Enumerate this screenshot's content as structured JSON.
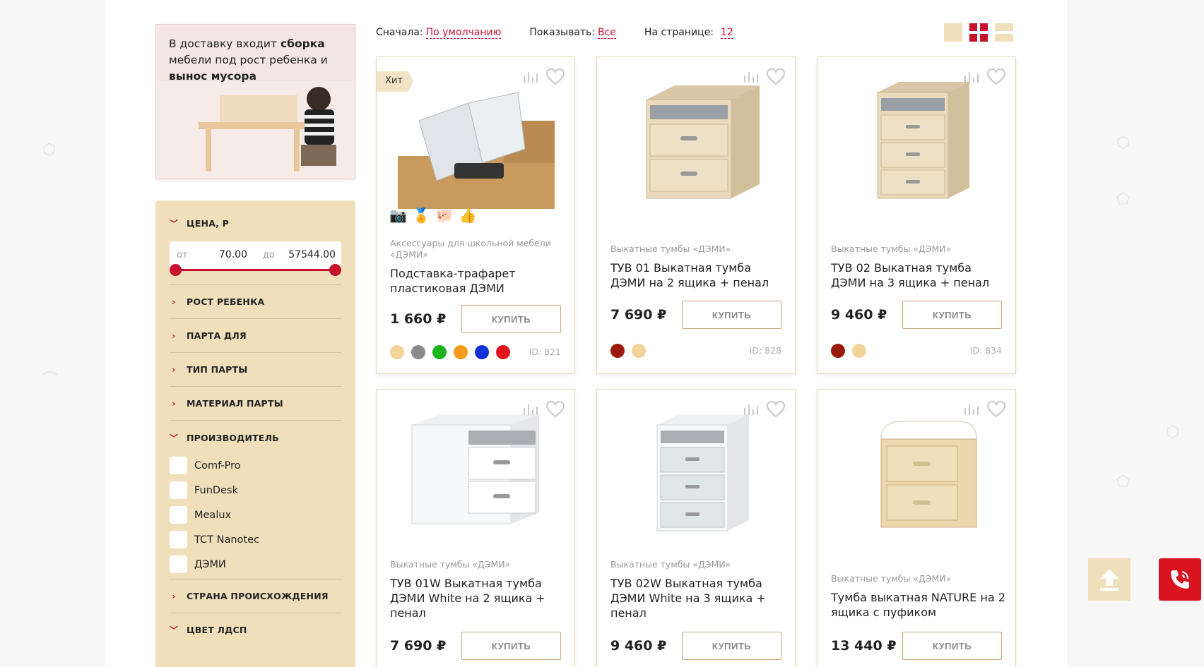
{
  "promo": {
    "line1_pre": "В доставку входит ",
    "line1_bold": "сборка",
    "line2": "мебели под рост ребенка и",
    "line3_bold": "вынос мусора"
  },
  "filters": {
    "price": {
      "label": "ЦЕНА, Р",
      "from_label": "от",
      "from_value": "70.00",
      "to_label": "до",
      "to_value": "57544.00",
      "range_fraction": [
        0,
        1
      ]
    },
    "sections": [
      "РОСТ РЕБЕНКА",
      "ПАРТА ДЛЯ",
      "ТИП ПАРТЫ",
      "МАТЕРИАЛ ПАРТЫ"
    ],
    "manufacturer": {
      "label": "ПРОИЗВОДИТЕЛЬ",
      "options": [
        "Comf-Pro",
        "FunDesk",
        "Mealux",
        "TCT Nanotec",
        "ДЭМИ"
      ]
    },
    "country": "СТРАНА ПРОИСХОЖДЕНИЯ",
    "color": "ЦВЕТ ЛДСП"
  },
  "sortbar": {
    "sort_label": "Сначала:",
    "sort_value": "По умолчанию",
    "show_label": "Показывать:",
    "show_value": "Все",
    "perpage_label": "На странице:",
    "perpage_value": "12"
  },
  "colors": {
    "accent": "#c8102e",
    "beige": "#efdfbb"
  },
  "products": [
    {
      "badge": "Хит",
      "category": "Аксессуары для школьной мебели «ДЭМИ»",
      "title": "Подставка-трафарет пластиковая ДЭМИ",
      "price": "1 660 ₽",
      "buy": "КУПИТЬ",
      "id": "ID: 821",
      "swatches": [
        "#f2d49b",
        "#8a8a8a",
        "#1db31d",
        "#f59a1a",
        "#1233d6",
        "#e3111b"
      ]
    },
    {
      "category": "Выкатные тумбы «ДЭМИ»",
      "title": "ТУВ 01 Выкатная тумба ДЭМИ на 2 ящика + пенал",
      "price": "7 690 ₽",
      "buy": "КУПИТЬ",
      "id": "ID: 828",
      "swatches": [
        "#9c1a0c",
        "#f2d49b"
      ]
    },
    {
      "category": "Выкатные тумбы «ДЭМИ»",
      "title": "ТУВ 02 Выкатная тумба ДЭМИ на 3 ящика + пенал",
      "price": "9 460 ₽",
      "buy": "КУПИТЬ",
      "id": "ID: 834",
      "swatches": [
        "#9c1a0c",
        "#f2d49b"
      ]
    },
    {
      "category": "Выкатные тумбы «ДЭМИ»",
      "title": "ТУВ 01W Выкатная тумба ДЭМИ White на 2 ящика + пенал",
      "price": "7 690 ₽",
      "buy": "КУПИТЬ"
    },
    {
      "category": "Выкатные тумбы «ДЭМИ»",
      "title": "ТУВ 02W Выкатная тумба ДЭМИ White на 3 ящика + пенал",
      "price": "9 460 ₽",
      "buy": "КУПИТЬ"
    },
    {
      "category": "Выкатные тумбы «ДЭМИ»",
      "title": "Тумба выкатная NATURE на 2 ящика с пуфиком",
      "price": "13 440 ₽",
      "buy": "КУПИТЬ"
    }
  ]
}
